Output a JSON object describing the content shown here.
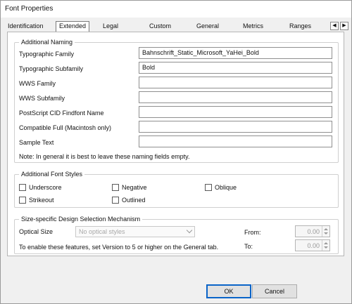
{
  "window": {
    "title": "Font Properties"
  },
  "tabs": [
    {
      "label": "Identification"
    },
    {
      "label": "Extended"
    },
    {
      "label": "Legal"
    },
    {
      "label": "Custom"
    },
    {
      "label": "General"
    },
    {
      "label": "Metrics"
    },
    {
      "label": "Ranges"
    }
  ],
  "tab_scroll": {
    "left": "◀",
    "right": "▶"
  },
  "additional_naming": {
    "legend": "Additional Naming",
    "fields": [
      {
        "label": "Typographic Family",
        "value": "Bahnschrift_Static_Microsoft_YaHei_Bold"
      },
      {
        "label": "Typographic Subfamily",
        "value": "Bold"
      },
      {
        "label": "WWS Family",
        "value": ""
      },
      {
        "label": "WWS Subfamily",
        "value": ""
      },
      {
        "label": "PostScript CID Findfont Name",
        "value": ""
      },
      {
        "label": "Compatible Full (Macintosh only)",
        "value": ""
      },
      {
        "label": "Sample Text",
        "value": ""
      }
    ],
    "note": "Note: In general it is best to leave these naming fields empty."
  },
  "font_styles": {
    "legend": "Additional Font Styles",
    "options": [
      {
        "label": "Underscore",
        "checked": false
      },
      {
        "label": "Negative",
        "checked": false
      },
      {
        "label": "Oblique",
        "checked": false
      },
      {
        "label": "Strikeout",
        "checked": false
      },
      {
        "label": "Outlined",
        "checked": false
      }
    ]
  },
  "size_design": {
    "legend": "Size-specific Design Selection Mechanism",
    "optical_size_label": "Optical Size",
    "optical_size_value": "No optical styles",
    "from_label": "From:",
    "from_value": "0.00",
    "to_label": "To:",
    "to_value": "0.00",
    "hint": "To enable these features, set Version to 5 or higher on the General tab."
  },
  "buttons": {
    "ok": "OK",
    "cancel": "Cancel"
  }
}
